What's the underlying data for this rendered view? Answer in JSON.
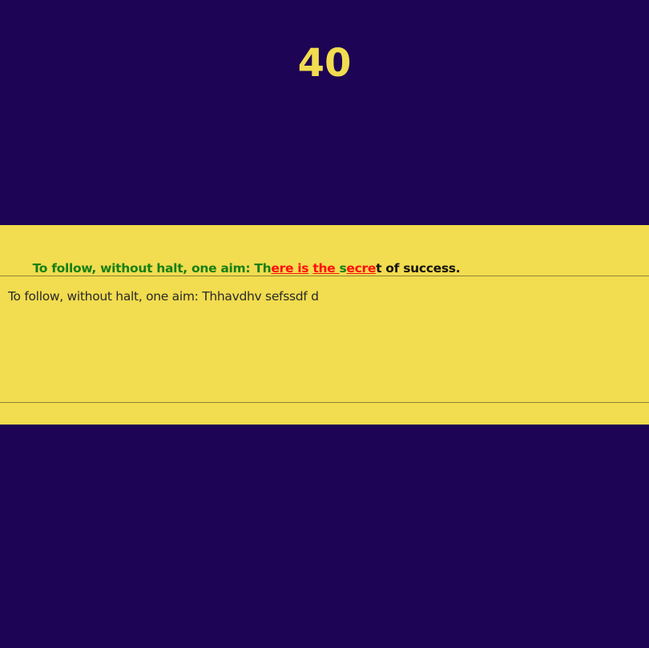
{
  "colors": {
    "background": "#1e0454",
    "accent": "#f2dc4f",
    "correct": "#178016",
    "wrong": "#ff0f0f",
    "pending": "#141414"
  },
  "timer": {
    "value": "40"
  },
  "target_text": {
    "segments": [
      {
        "text": "To follow, without halt, one aim: Th",
        "status": "correct"
      },
      {
        "text": "ere is",
        "status": "wrong"
      },
      {
        "text": " ",
        "status": "correct"
      },
      {
        "text": "the ",
        "status": "wrong"
      },
      {
        "text": "s",
        "status": "correct"
      },
      {
        "text": "ecre",
        "status": "wrong"
      },
      {
        "text": "t of success.",
        "status": "pending"
      }
    ]
  },
  "typing_area": {
    "value": "To follow, without halt, one aim: Thhavdhv sefssdf d"
  }
}
